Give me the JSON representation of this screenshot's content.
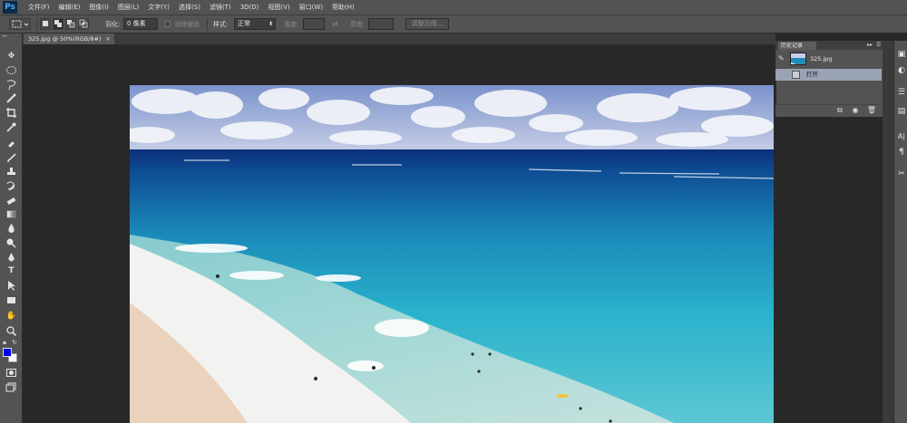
{
  "app": {
    "logo": "Ps"
  },
  "menu": [
    "文件(F)",
    "编辑(E)",
    "图像(I)",
    "图层(L)",
    "文字(Y)",
    "选择(S)",
    "滤镜(T)",
    "3D(D)",
    "视图(V)",
    "窗口(W)",
    "帮助(H)"
  ],
  "options": {
    "feather_label": "羽化:",
    "feather_value": "0 像素",
    "antialias_label": "消除锯齿",
    "style_label": "样式:",
    "style_value": "正常",
    "width_label": "宽度:",
    "height_label": "高度:",
    "refine_edge_label": "调整边缘..."
  },
  "document": {
    "tab_title": "325.jpg @ 50%(RGB/8#)",
    "close_glyph": "×"
  },
  "colors": {
    "foreground": "#0000ee",
    "background": "#ffffff"
  },
  "history": {
    "panel_title": "历史记录",
    "snapshot_name": "325.jpg",
    "states": [
      "打开"
    ]
  },
  "icons": {
    "tools": [
      "move-icon",
      "marquee-icon",
      "lasso-icon",
      "quick-select-icon",
      "crop-icon",
      "eyedropper-icon",
      "healing-brush-icon",
      "brush-icon",
      "clone-stamp-icon",
      "history-brush-icon",
      "eraser-icon",
      "gradient-icon",
      "blur-icon",
      "dodge-icon",
      "pen-icon",
      "type-icon",
      "path-select-icon",
      "rectangle-icon",
      "hand-icon",
      "zoom-icon"
    ],
    "dock": [
      "layers-icon",
      "adjustments-icon",
      "character-icon",
      "paragraph-icon",
      "tool-presets-icon"
    ]
  }
}
